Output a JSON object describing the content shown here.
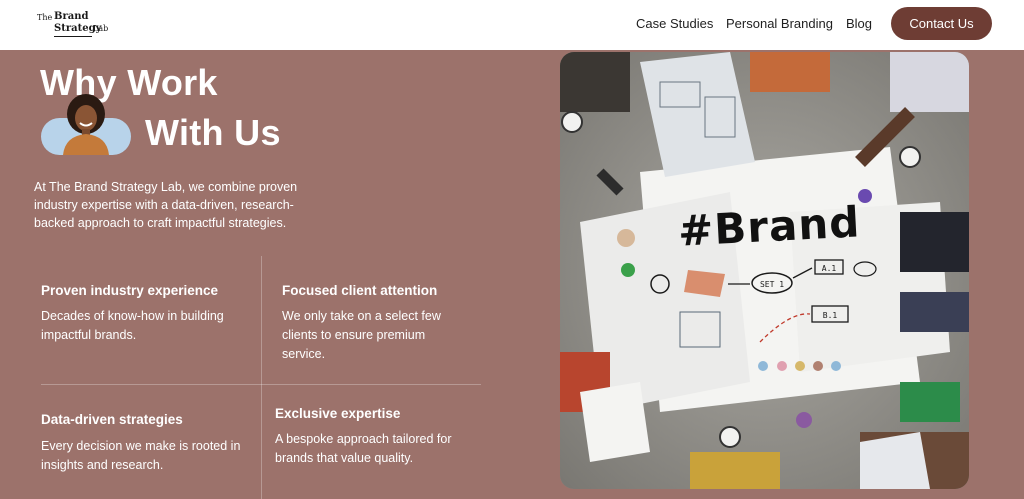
{
  "header": {
    "logo": {
      "the": "The",
      "brand": "Brand",
      "strategy": "Strategy",
      "lab": "Lab"
    },
    "nav": [
      "Case Studies",
      "Personal Branding",
      "Blog"
    ],
    "cta": "Contact Us"
  },
  "hero": {
    "title_line1": "Why Work",
    "title_line2": "With Us",
    "intro": "At The Brand Strategy Lab, we combine proven industry expertise with a data-driven, research-backed approach to craft impactful strategies."
  },
  "features": [
    {
      "title": "Proven industry experience",
      "desc": "Decades of know-how in building impactful brands."
    },
    {
      "title": "Focused client attention",
      "desc": "We only take on a select few clients to ensure premium service."
    },
    {
      "title": "Data-driven strategies",
      "desc": "Every decision we make is rooted in insights and research."
    },
    {
      "title": "Exclusive expertise",
      "desc": "A bespoke approach tailored for brands that value quality."
    }
  ],
  "photo": {
    "handwritten": "#Brand",
    "note_labels": [
      "SET 1",
      "A.1",
      "B.1"
    ]
  },
  "colors": {
    "background": "#9c726b",
    "cta": "#6e3d34",
    "header": "#ffffff",
    "avatar_bg": "#b8d3ea"
  }
}
